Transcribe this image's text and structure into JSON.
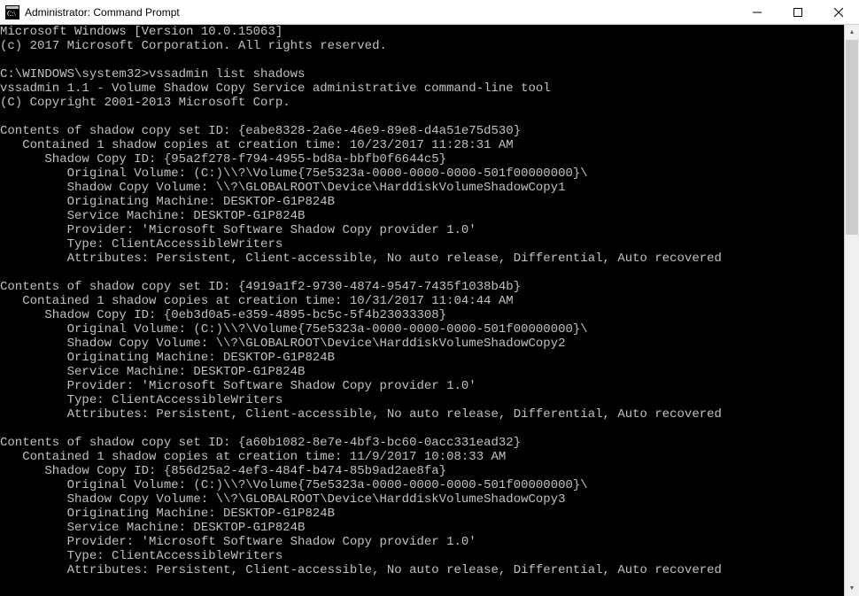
{
  "window": {
    "title": "Administrator: Command Prompt"
  },
  "header": {
    "version_line": "Microsoft Windows [Version 10.0.15063]",
    "copyright_line": "(c) 2017 Microsoft Corporation. All rights reserved."
  },
  "prompt": {
    "path": "C:\\WINDOWS\\system32>",
    "command": "vssadmin list shadows"
  },
  "vss_banner": {
    "line1": "vssadmin 1.1 - Volume Shadow Copy Service administrative command-line tool",
    "line2": "(C) Copyright 2001-2013 Microsoft Corp."
  },
  "sets": [
    {
      "set_id_line": "Contents of shadow copy set ID: {eabe8328-2a6e-46e9-89e8-d4a51e75d530}",
      "creation_line": "   Contained 1 shadow copies at creation time: 10/23/2017 11:28:31 AM",
      "copy_id_line": "      Shadow Copy ID: {95a2f278-f794-4955-bd8a-bbfb0f6644c5}",
      "orig_vol_line": "         Original Volume: (C:)\\\\?\\Volume{75e5323a-0000-0000-0000-501f00000000}\\",
      "shadow_vol_line": "         Shadow Copy Volume: \\\\?\\GLOBALROOT\\Device\\HarddiskVolumeShadowCopy1",
      "orig_machine_line": "         Originating Machine: DESKTOP-G1P824B",
      "service_machine_line": "         Service Machine: DESKTOP-G1P824B",
      "provider_line": "         Provider: 'Microsoft Software Shadow Copy provider 1.0'",
      "type_line": "         Type: ClientAccessibleWriters",
      "attrs_line": "         Attributes: Persistent, Client-accessible, No auto release, Differential, Auto recovered"
    },
    {
      "set_id_line": "Contents of shadow copy set ID: {4919a1f2-9730-4874-9547-7435f1038b4b}",
      "creation_line": "   Contained 1 shadow copies at creation time: 10/31/2017 11:04:44 AM",
      "copy_id_line": "      Shadow Copy ID: {0eb3d0a5-e359-4895-bc5c-5f4b23033308}",
      "orig_vol_line": "         Original Volume: (C:)\\\\?\\Volume{75e5323a-0000-0000-0000-501f00000000}\\",
      "shadow_vol_line": "         Shadow Copy Volume: \\\\?\\GLOBALROOT\\Device\\HarddiskVolumeShadowCopy2",
      "orig_machine_line": "         Originating Machine: DESKTOP-G1P824B",
      "service_machine_line": "         Service Machine: DESKTOP-G1P824B",
      "provider_line": "         Provider: 'Microsoft Software Shadow Copy provider 1.0'",
      "type_line": "         Type: ClientAccessibleWriters",
      "attrs_line": "         Attributes: Persistent, Client-accessible, No auto release, Differential, Auto recovered"
    },
    {
      "set_id_line": "Contents of shadow copy set ID: {a60b1082-8e7e-4bf3-bc60-0acc331ead32}",
      "creation_line": "   Contained 1 shadow copies at creation time: 11/9/2017 10:08:33 AM",
      "copy_id_line": "      Shadow Copy ID: {856d25a2-4ef3-484f-b474-85b9ad2ae8fa}",
      "orig_vol_line": "         Original Volume: (C:)\\\\?\\Volume{75e5323a-0000-0000-0000-501f00000000}\\",
      "shadow_vol_line": "         Shadow Copy Volume: \\\\?\\GLOBALROOT\\Device\\HarddiskVolumeShadowCopy3",
      "orig_machine_line": "         Originating Machine: DESKTOP-G1P824B",
      "service_machine_line": "         Service Machine: DESKTOP-G1P824B",
      "provider_line": "         Provider: 'Microsoft Software Shadow Copy provider 1.0'",
      "type_line": "         Type: ClientAccessibleWriters",
      "attrs_line": "         Attributes: Persistent, Client-accessible, No auto release, Differential, Auto recovered"
    }
  ]
}
